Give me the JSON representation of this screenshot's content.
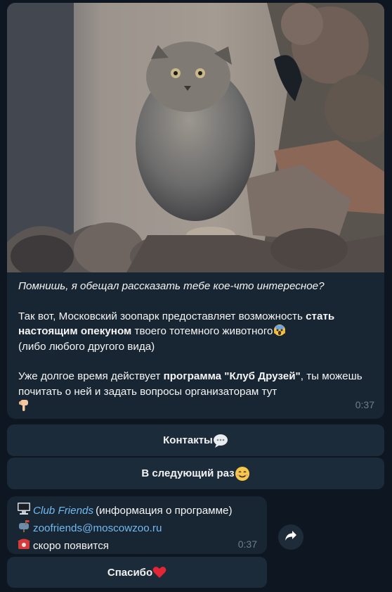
{
  "post": {
    "intro": "Помнишь, я обещал рассказать тебе кое-что интересное?",
    "p2_a": "Так вот, Московский зоопарк предоставляет возможность ",
    "p2_b": "стать настоящим опекуном",
    "p2_c": " твоего тотемного животного",
    "p2_d": "(либо любого другого вида)",
    "p3_a": "Уже долгое время действует ",
    "p3_b": "программа \"Клуб Друзей\"",
    "p3_c": ", ты можешь почитать о ней и задать вопросы организаторам тут",
    "time": "0:37",
    "icons": [
      "scared-face-emoji",
      "pointing-down-emoji"
    ]
  },
  "buttons": {
    "contacts": "Контакты",
    "next_time": "В следующий раз",
    "thanks": "Спасибо"
  },
  "info": {
    "club_name": "Club Friends",
    "club_desc": " (информация о программе)",
    "email": "zoofriends@moscowzoo.ru",
    "phone_text": " скоро появится",
    "time": "0:37",
    "icons": [
      "computer-icon",
      "mailbox-icon",
      "telephone-icon",
      "forward-icon"
    ]
  },
  "colors": {
    "background": "#0e1621",
    "bubble": "#182533",
    "button": "#1c2b3a",
    "link": "#71baf1",
    "time": "#6d7f8f"
  }
}
